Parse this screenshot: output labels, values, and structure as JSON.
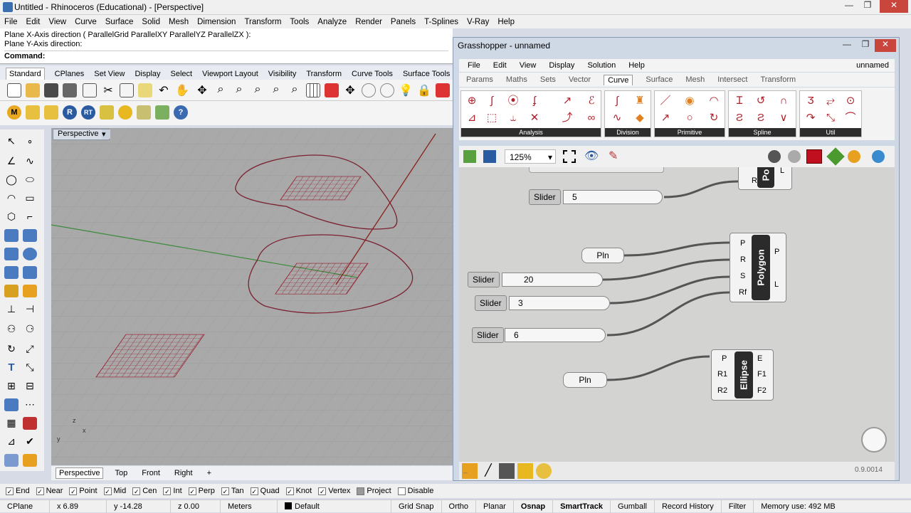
{
  "window": {
    "title": "Untitled - Rhinoceros (Educational) - [Perspective]"
  },
  "menu": [
    "File",
    "Edit",
    "View",
    "Curve",
    "Surface",
    "Solid",
    "Mesh",
    "Dimension",
    "Transform",
    "Tools",
    "Analyze",
    "Render",
    "Panels",
    "T-Splines",
    "V-Ray",
    "Help"
  ],
  "command": {
    "line1": "Plane X-Axis direction ( ParallelGrid  ParallelXY  ParallelYZ  ParallelZX ):",
    "line2": "Plane Y-Axis direction:",
    "prompt": "Command:"
  },
  "tabs": [
    "Standard",
    "CPlanes",
    "Set View",
    "Display",
    "Select",
    "Viewport Layout",
    "Visibility",
    "Transform",
    "Curve Tools",
    "Surface Tools"
  ],
  "viewport": {
    "label": "Perspective",
    "tabs": [
      "Perspective",
      "Top",
      "Front",
      "Right"
    ],
    "add_tab": "+"
  },
  "osnaps": [
    {
      "label": "End",
      "checked": true
    },
    {
      "label": "Near",
      "checked": true
    },
    {
      "label": "Point",
      "checked": true
    },
    {
      "label": "Mid",
      "checked": true
    },
    {
      "label": "Cen",
      "checked": true
    },
    {
      "label": "Int",
      "checked": true
    },
    {
      "label": "Perp",
      "checked": true
    },
    {
      "label": "Tan",
      "checked": true
    },
    {
      "label": "Quad",
      "checked": true
    },
    {
      "label": "Knot",
      "checked": true
    },
    {
      "label": "Vertex",
      "checked": true
    },
    {
      "label": "Project",
      "checked": false
    },
    {
      "label": "Disable",
      "checked": false
    }
  ],
  "status": {
    "cplane": "CPlane",
    "x": "x 6.89",
    "y": "y -14.28",
    "z": "z 0.00",
    "units": "Meters",
    "layer": "Default",
    "items": [
      "Grid Snap",
      "Ortho",
      "Planar",
      "Osnap",
      "SmartTrack",
      "Gumball",
      "Record History",
      "Filter"
    ],
    "memory": "Memory use: 492 MB"
  },
  "gh": {
    "title": "Grasshopper - unnamed",
    "menu": [
      "File",
      "Edit",
      "View",
      "Display",
      "Solution",
      "Help"
    ],
    "doc": "unnamed",
    "tabs": [
      "Params",
      "Maths",
      "Sets",
      "Vector",
      "Curve",
      "Surface",
      "Mesh",
      "Intersect",
      "Transform"
    ],
    "groups": [
      "Analysis",
      "Division",
      "Primitive",
      "Spline",
      "Util"
    ],
    "zoom": "125%",
    "version": "0.9.0014",
    "bottom_text": "_",
    "slider_label": "Slider",
    "pln_label": "Pln",
    "sliders": [
      {
        "value": "5"
      },
      {
        "value": "20"
      },
      {
        "value": "3"
      },
      {
        "value": "6"
      }
    ],
    "polygon": {
      "name": "Polygon",
      "inputs": [
        "P",
        "R",
        "S",
        "Rf"
      ],
      "outputs": [
        "P",
        "L"
      ]
    },
    "ellipse": {
      "name": "Ellipse",
      "inputs": [
        "P",
        "R1",
        "R2"
      ],
      "outputs": [
        "E",
        "F1",
        "F2"
      ]
    },
    "top_comp": {
      "name": "Po",
      "inputs": [
        "Rf"
      ],
      "outputs": [
        "L"
      ]
    }
  }
}
